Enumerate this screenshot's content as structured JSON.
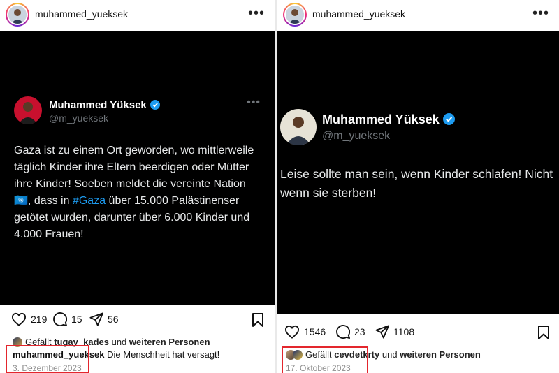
{
  "left_post": {
    "username": "muhammed_yueksek",
    "tweet": {
      "name": "Muhammed Yüksek",
      "handle": "@m_yueksek",
      "text_before": "Gaza ist zu einem Ort geworden, wo mittlerweile täglich Kinder ihre Eltern beerdigen oder Mütter ihre Kinder! Soeben meldet die vereinte Nation 🇺🇳, dass in ",
      "hashtag": "#Gaza",
      "text_after": " über 15.000 Palästinenser getötet wurden, darunter über 6.000 Kinder und 4.000 Frauen!"
    },
    "likes_count": "219",
    "comments_count": "15",
    "shares_count": "56",
    "liked_by_prefix": "Gefällt",
    "liked_by_user": "tugay_kades",
    "liked_by_mid": "und",
    "liked_by_suffix": "weiteren Personen",
    "caption_user": "muhammed_yueksek",
    "caption_text": "Die Menschheit hat versagt!",
    "date": "3. Dezember 2023"
  },
  "right_post": {
    "username": "muhammed_yueksek",
    "tweet": {
      "name": "Muhammed Yüksek",
      "handle": "@m_yueksek",
      "text": "Leise sollte man sein, wenn Kinder schlafen! Nicht wenn sie sterben!"
    },
    "likes_count": "1546",
    "comments_count": "23",
    "shares_count": "1108",
    "liked_by_prefix": "Gefällt",
    "liked_by_user": "cevdetkrty",
    "liked_by_mid": "und",
    "liked_by_suffix": "weiteren Personen",
    "date": "17. Oktober 2023"
  },
  "colors": {
    "verified": "#1d9bf0",
    "hashtag": "#1d9bf0",
    "highlight_box": "#e3262d"
  },
  "icons": [
    "heart-icon",
    "comment-icon",
    "share-icon",
    "bookmark-icon",
    "more-icon",
    "verified-icon"
  ]
}
